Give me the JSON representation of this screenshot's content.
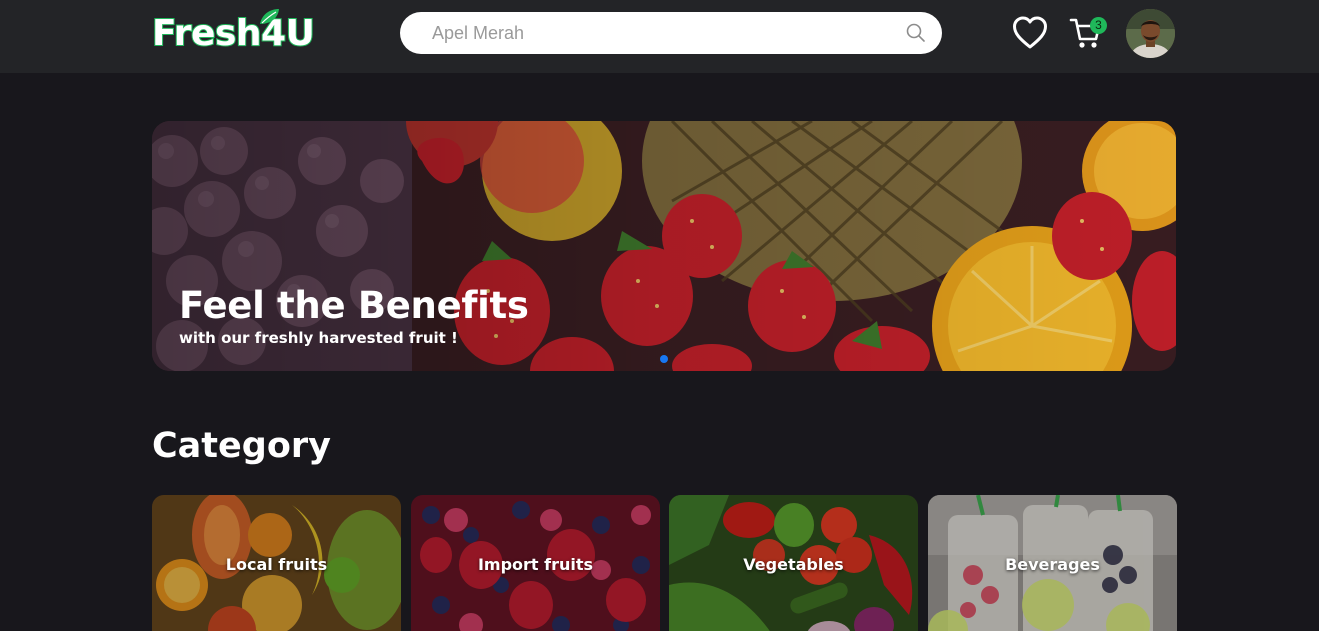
{
  "header": {
    "logo": {
      "part1": "Fresh",
      "part2": "4U"
    },
    "search": {
      "placeholder": "Apel Merah"
    },
    "cart_count": "3",
    "icons": [
      "heart-icon",
      "cart-icon",
      "search-icon",
      "leaf-icon"
    ]
  },
  "hero": {
    "title": "Feel the Benefits",
    "subtitle": "with our freshly harvested fruit !",
    "active_slide": 1
  },
  "category": {
    "title": "Category",
    "items": [
      {
        "label": "Local fruits"
      },
      {
        "label": "Import fruits"
      },
      {
        "label": "Vegetables"
      },
      {
        "label": "Beverages"
      }
    ]
  },
  "colors": {
    "background": "#18171c",
    "header": "#232427",
    "brand_green": "#1fb85a",
    "slider_dot": "#1877f2"
  }
}
